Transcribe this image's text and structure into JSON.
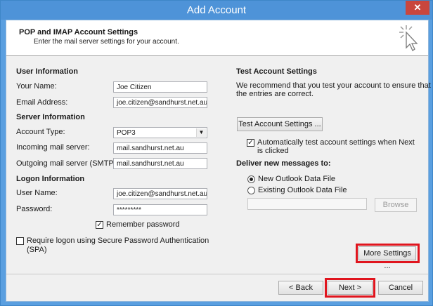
{
  "window": {
    "title": "Add Account",
    "close_glyph": "✕"
  },
  "header": {
    "title": "POP and IMAP Account Settings",
    "subtitle": "Enter the mail server settings for your account.",
    "icon": "cursor-click-icon"
  },
  "user_info": {
    "heading": "User Information",
    "name_label": "Your Name:",
    "name_value": "Joe Citizen",
    "email_label": "Email Address:",
    "email_value": "joe.citizen@sandhurst.net.au"
  },
  "server_info": {
    "heading": "Server Information",
    "account_type_label": "Account Type:",
    "account_type_value": "POP3",
    "incoming_label": "Incoming mail server:",
    "incoming_value": "mail.sandhurst.net.au",
    "outgoing_label": "Outgoing mail server (SMTP):",
    "outgoing_value": "mail.sandhurst.net.au"
  },
  "logon_info": {
    "heading": "Logon Information",
    "username_label": "User Name:",
    "username_value": "joe.citizen@sandhurst.net.au",
    "password_label": "Password:",
    "password_value": "*********",
    "remember_label": "Remember password",
    "remember_checked": true,
    "spa_label": "Require logon using Secure Password Authentication",
    "spa_label_2": "(SPA)",
    "spa_checked": false
  },
  "test_settings": {
    "heading": "Test Account Settings",
    "description_1": "We recommend that you test your account to ensure that",
    "description_2": "the entries are correct.",
    "test_button": "Test Account Settings ...",
    "auto_test_label_1": "Automatically test account settings when Next",
    "auto_test_label_2": "is clicked",
    "auto_test_checked": true
  },
  "deliver": {
    "heading": "Deliver new messages to:",
    "new_file_label": "New Outlook Data File",
    "existing_file_label": "Existing Outlook Data File",
    "browse_button": "Browse",
    "path_value": ""
  },
  "more_settings_button": "More Settings ...",
  "footer": {
    "back_button": "< Back",
    "next_button": "Next >",
    "cancel_button": "Cancel"
  },
  "colors": {
    "title_bar": "#4e93d8",
    "highlight": "#e0151e",
    "dialog_bg": "#f0f0f0"
  }
}
